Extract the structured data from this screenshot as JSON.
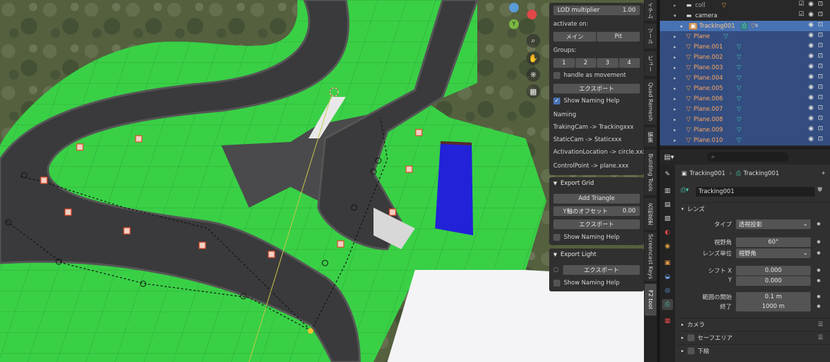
{
  "colors": {
    "accent": "#4772b3",
    "grass": "#39d046",
    "asphalt": "#3a3a3c",
    "blue_box": "#2222d8",
    "object_orange": "#e69a4a",
    "camera_teal": "#48c9b0"
  },
  "viewport": {
    "nav_icons": [
      "zoom-icon",
      "hand-icon",
      "camera-icon",
      "grid-icon"
    ],
    "gizmo": {
      "y_label": "Y"
    }
  },
  "n_panel": {
    "lod_label": "LOD multiplier",
    "lod_value": "1.00",
    "activate_on": "activate on:",
    "activate_buttons": [
      "メイン",
      "Pit"
    ],
    "groups_label": "Groups:",
    "groups": [
      "1",
      "2",
      "3",
      "4"
    ],
    "handle_as_movement": "handle as movement",
    "export_button": "エクスポート",
    "show_naming_help": "Show Naming Help",
    "naming_lines": [
      "Naming",
      "TrakingCam -> Trackingxxx",
      "StaticCam -> Staticxxx",
      "ActivationLocation -> circle.xxx",
      "ControlPoint -> plane.xxx"
    ],
    "export_grid": {
      "title": "Export Grid",
      "add_triangle": "Add Triangle",
      "offset_label": "Y軸のオフセット",
      "offset_value": "0.00",
      "export_button": "エクスポート",
      "show_naming_help": "Show Naming Help"
    },
    "export_light": {
      "title": "Export Light",
      "export_button": "エクスポート",
      "show_naming_help": "Show Naming Help"
    }
  },
  "n_tabs": [
    "イテム",
    "ツール",
    "ビュー",
    "Quad Remesh",
    "編集",
    "Building Tools",
    "名前変更",
    "Screencast Keys",
    "F2 tool"
  ],
  "outliner": {
    "rows": [
      {
        "name": "coll"
      },
      {
        "name": "camera"
      },
      {
        "name": "Tracking001"
      },
      {
        "name": "Plane"
      },
      {
        "name": "Plane.001"
      },
      {
        "name": "Plane.002"
      },
      {
        "name": "Plane.003"
      },
      {
        "name": "Plane.004"
      },
      {
        "name": "Plane.005"
      },
      {
        "name": "Plane.006"
      },
      {
        "name": "Plane.007"
      },
      {
        "name": "Plane.008"
      },
      {
        "name": "Plane.009"
      },
      {
        "name": "Plane.010"
      }
    ],
    "tracking_badge": "9"
  },
  "properties": {
    "breadcrumb_object": "Tracking001",
    "breadcrumb_data": "Tracking001",
    "data_name": "Tracking001",
    "lens_section": "レンズ",
    "type_label": "タイプ",
    "type_value": "透視投影",
    "fov_label": "視野角",
    "fov_value": "60°",
    "lens_unit_label": "レンズ単位",
    "lens_unit_value": "視野角",
    "shift_label": "シフト X",
    "shift_x": "0.000",
    "y_label": "Y",
    "shift_y": "0.000",
    "clip_start_label": "範囲の開始",
    "clip_start": "0.1 m",
    "clip_end_label": "終了",
    "clip_end": "1000 m",
    "sections": [
      "カメラ",
      "セーフエリア",
      "下絵"
    ]
  }
}
